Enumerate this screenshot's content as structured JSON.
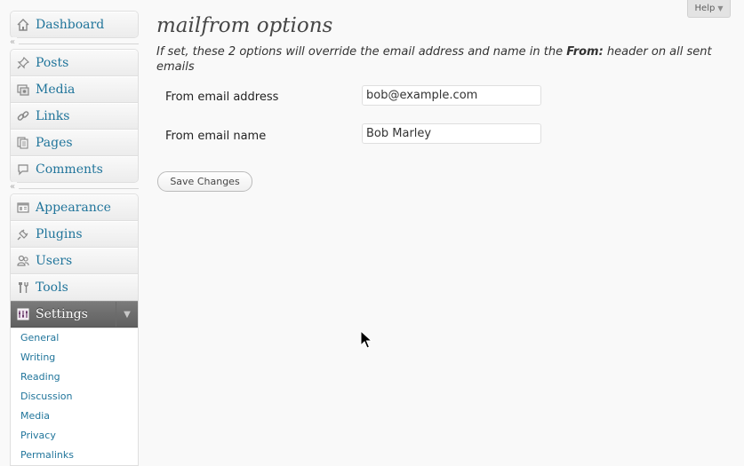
{
  "sidebar": {
    "group1": [
      {
        "label": "Dashboard",
        "icon": "dashboard-icon"
      }
    ],
    "group2": [
      {
        "label": "Posts",
        "icon": "pushpin-icon"
      },
      {
        "label": "Media",
        "icon": "media-icon"
      },
      {
        "label": "Links",
        "icon": "chain-link-icon"
      },
      {
        "label": "Pages",
        "icon": "pages-icon"
      },
      {
        "label": "Comments",
        "icon": "speech-bubble-icon"
      }
    ],
    "group3": [
      {
        "label": "Appearance",
        "icon": "appearance-icon"
      },
      {
        "label": "Plugins",
        "icon": "plug-icon"
      },
      {
        "label": "Users",
        "icon": "users-icon"
      },
      {
        "label": "Tools",
        "icon": "tools-icon"
      },
      {
        "label": "Settings",
        "icon": "settings-icon"
      }
    ],
    "submenu": [
      "General",
      "Writing",
      "Reading",
      "Discussion",
      "Media",
      "Privacy",
      "Permalinks"
    ],
    "collapse_glyph": "«",
    "current_toggle_glyph": "▼"
  },
  "help": {
    "label": "Help",
    "arrow": "▼"
  },
  "main": {
    "title": "mailfrom options",
    "description_before": "If set, these 2 options will override the email address and name in the ",
    "description_bold": "From:",
    "description_after": " header on all sent emails",
    "fields": [
      {
        "label": "From email address",
        "value": "bob@example.com"
      },
      {
        "label": "From email name",
        "value": "Bob Marley"
      }
    ],
    "save_label": "Save Changes"
  },
  "colors": {
    "link": "#21759b",
    "current_menu": "#6d6d6d",
    "background": "#f9f9f9"
  }
}
